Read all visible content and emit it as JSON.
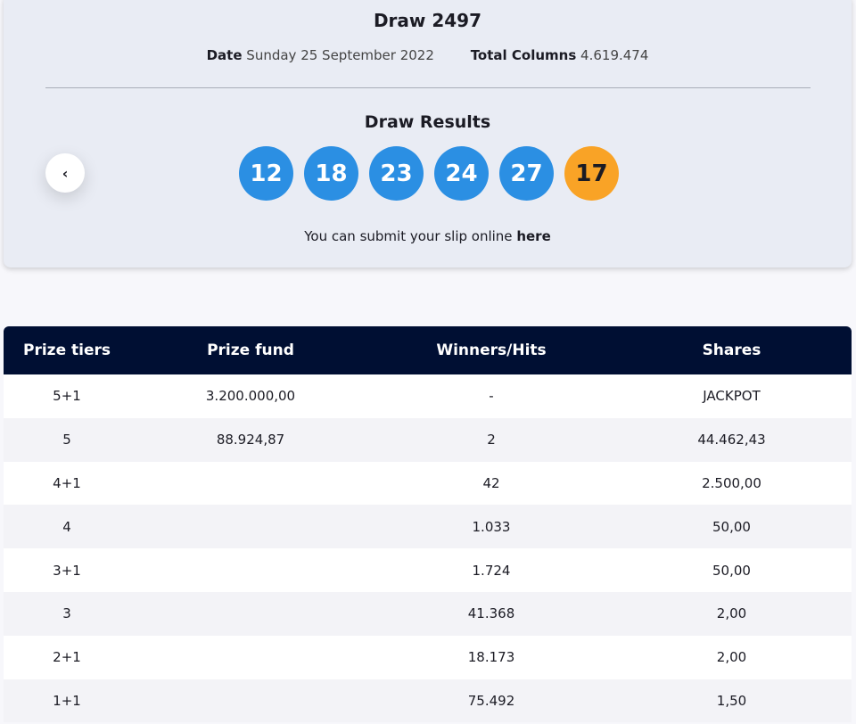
{
  "header": {
    "title": "Draw 2497",
    "date_label": "Date",
    "date_value": "Sunday 25 September 2022",
    "columns_label": "Total Columns",
    "columns_value": "4.619.474"
  },
  "results": {
    "title": "Draw Results",
    "numbers": [
      "12",
      "18",
      "23",
      "24",
      "27"
    ],
    "bonus": "17",
    "submit_prefix": "You can submit your slip online",
    "submit_link": "here"
  },
  "colors": {
    "ball_main": "#2b8fe3",
    "ball_bonus": "#f9a326",
    "table_header": "#000f33"
  },
  "table": {
    "headers": [
      "Prize tiers",
      "Prize fund",
      "Winners/Hits",
      "Shares"
    ],
    "rows": [
      [
        "5+1",
        "3.200.000,00",
        "-",
        "JACKPOT"
      ],
      [
        "5",
        "88.924,87",
        "2",
        "44.462,43"
      ],
      [
        "4+1",
        "",
        "42",
        "2.500,00"
      ],
      [
        "4",
        "",
        "1.033",
        "50,00"
      ],
      [
        "3+1",
        "",
        "1.724",
        "50,00"
      ],
      [
        "3",
        "",
        "41.368",
        "2,00"
      ],
      [
        "2+1",
        "",
        "18.173",
        "2,00"
      ],
      [
        "1+1",
        "",
        "75.492",
        "1,50"
      ]
    ]
  }
}
